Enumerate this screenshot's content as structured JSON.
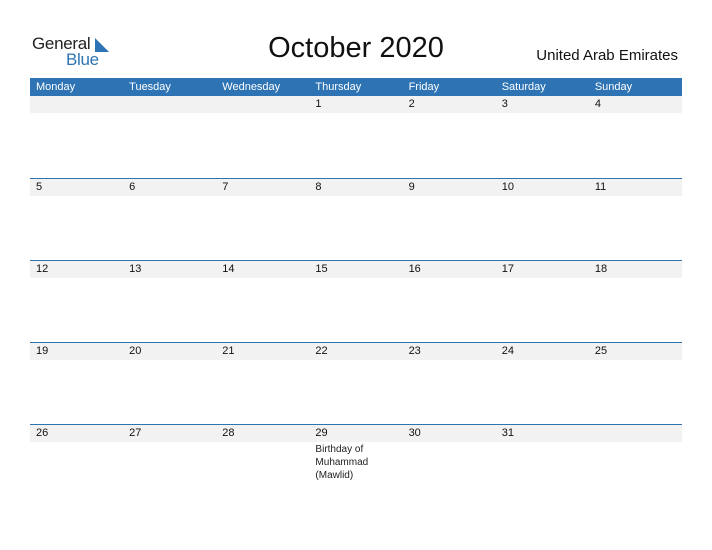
{
  "logo": {
    "general": "General",
    "blue": "Blue"
  },
  "title": "October 2020",
  "country": "United Arab Emirates",
  "colors": {
    "accent": "#2e74b5",
    "band": "#f2f2f2"
  },
  "weekdays": [
    "Monday",
    "Tuesday",
    "Wednesday",
    "Thursday",
    "Friday",
    "Saturday",
    "Sunday"
  ],
  "weeks": [
    [
      {
        "day": ""
      },
      {
        "day": ""
      },
      {
        "day": ""
      },
      {
        "day": "1"
      },
      {
        "day": "2"
      },
      {
        "day": "3"
      },
      {
        "day": "4"
      }
    ],
    [
      {
        "day": "5"
      },
      {
        "day": "6"
      },
      {
        "day": "7"
      },
      {
        "day": "8"
      },
      {
        "day": "9"
      },
      {
        "day": "10"
      },
      {
        "day": "11"
      }
    ],
    [
      {
        "day": "12"
      },
      {
        "day": "13"
      },
      {
        "day": "14"
      },
      {
        "day": "15"
      },
      {
        "day": "16"
      },
      {
        "day": "17"
      },
      {
        "day": "18"
      }
    ],
    [
      {
        "day": "19"
      },
      {
        "day": "20"
      },
      {
        "day": "21"
      },
      {
        "day": "22"
      },
      {
        "day": "23"
      },
      {
        "day": "24"
      },
      {
        "day": "25"
      }
    ],
    [
      {
        "day": "26"
      },
      {
        "day": "27"
      },
      {
        "day": "28"
      },
      {
        "day": "29",
        "event": "Birthday of Muhammad (Mawlid)"
      },
      {
        "day": "30"
      },
      {
        "day": "31"
      },
      {
        "day": ""
      }
    ]
  ]
}
